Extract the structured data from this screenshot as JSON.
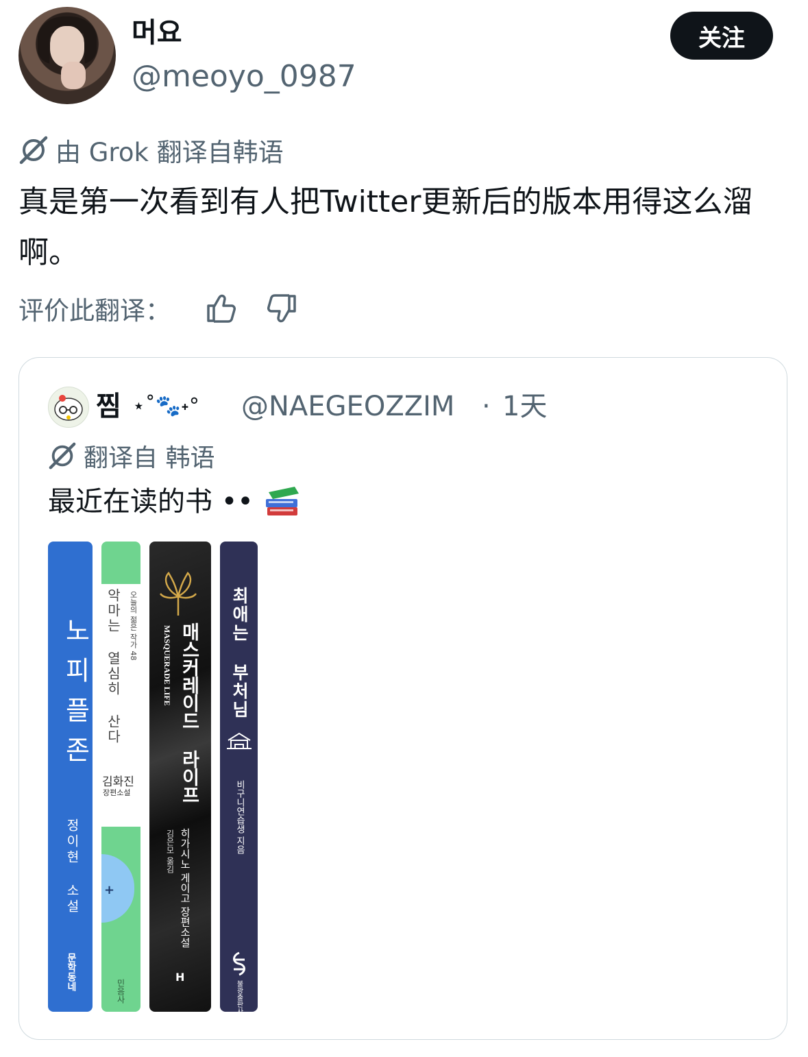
{
  "tweet": {
    "display_name": "머요",
    "handle": "@meoyo_0987",
    "follow_label": "关注",
    "grok_label": "由 Grok 翻译自韩语",
    "text": "真是第一次看到有人把Twitter更新后的版本用得这么溜啊。",
    "rate_label": "评价此翻译："
  },
  "quote": {
    "display_name": "찜",
    "name_decoration": "⋆˚🐾˖°",
    "handle": "@NAEGEOZZIM",
    "separator": "·",
    "time": "1天",
    "translate_label": "翻译自 韩语",
    "text": "最近在读的书 ••"
  },
  "books": [
    {
      "title": "노피플존",
      "author": "정이현 소설",
      "publisher": "문학동네",
      "color": "#2f6fd0"
    },
    {
      "title": "악마는 열심히 산다",
      "series": "오늘의 젊은 작가 48",
      "author": "김화진",
      "author_sub": "장편소설",
      "publisher": "민음사",
      "color": "#6fd48f"
    },
    {
      "title": "매스커레이드 라이프",
      "title_en": "MASQUERADE LIFE",
      "author": "히가시노 게이고 장편소설",
      "translator": "김은모 옮김",
      "publisher": "H",
      "color": "#1c1c1c"
    },
    {
      "title": "최애는 부처님",
      "author": "비구니연습생 지음",
      "publisher": "불광출판사",
      "color": "#2f3156"
    }
  ],
  "colors": {
    "text": "#0f1419",
    "muted": "#536471",
    "border": "#cfd9de"
  }
}
